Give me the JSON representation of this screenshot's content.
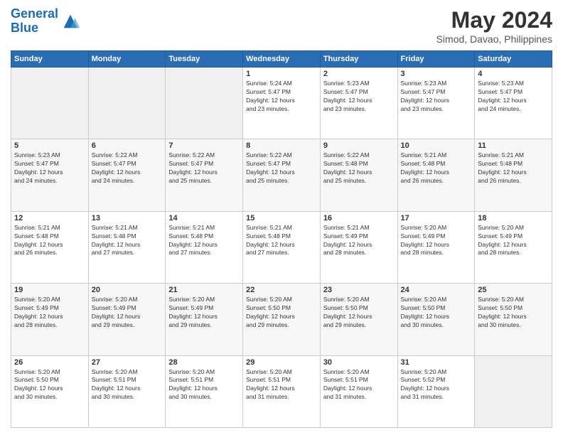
{
  "header": {
    "logo_line1": "General",
    "logo_line2": "Blue",
    "month_year": "May 2024",
    "location": "Simod, Davao, Philippines"
  },
  "weekdays": [
    "Sunday",
    "Monday",
    "Tuesday",
    "Wednesday",
    "Thursday",
    "Friday",
    "Saturday"
  ],
  "weeks": [
    [
      {
        "day": "",
        "info": ""
      },
      {
        "day": "",
        "info": ""
      },
      {
        "day": "",
        "info": ""
      },
      {
        "day": "1",
        "info": "Sunrise: 5:24 AM\nSunset: 5:47 PM\nDaylight: 12 hours\nand 23 minutes."
      },
      {
        "day": "2",
        "info": "Sunrise: 5:23 AM\nSunset: 5:47 PM\nDaylight: 12 hours\nand 23 minutes."
      },
      {
        "day": "3",
        "info": "Sunrise: 5:23 AM\nSunset: 5:47 PM\nDaylight: 12 hours\nand 23 minutes."
      },
      {
        "day": "4",
        "info": "Sunrise: 5:23 AM\nSunset: 5:47 PM\nDaylight: 12 hours\nand 24 minutes."
      }
    ],
    [
      {
        "day": "5",
        "info": "Sunrise: 5:23 AM\nSunset: 5:47 PM\nDaylight: 12 hours\nand 24 minutes."
      },
      {
        "day": "6",
        "info": "Sunrise: 5:22 AM\nSunset: 5:47 PM\nDaylight: 12 hours\nand 24 minutes."
      },
      {
        "day": "7",
        "info": "Sunrise: 5:22 AM\nSunset: 5:47 PM\nDaylight: 12 hours\nand 25 minutes."
      },
      {
        "day": "8",
        "info": "Sunrise: 5:22 AM\nSunset: 5:47 PM\nDaylight: 12 hours\nand 25 minutes."
      },
      {
        "day": "9",
        "info": "Sunrise: 5:22 AM\nSunset: 5:48 PM\nDaylight: 12 hours\nand 25 minutes."
      },
      {
        "day": "10",
        "info": "Sunrise: 5:21 AM\nSunset: 5:48 PM\nDaylight: 12 hours\nand 26 minutes."
      },
      {
        "day": "11",
        "info": "Sunrise: 5:21 AM\nSunset: 5:48 PM\nDaylight: 12 hours\nand 26 minutes."
      }
    ],
    [
      {
        "day": "12",
        "info": "Sunrise: 5:21 AM\nSunset: 5:48 PM\nDaylight: 12 hours\nand 26 minutes."
      },
      {
        "day": "13",
        "info": "Sunrise: 5:21 AM\nSunset: 5:48 PM\nDaylight: 12 hours\nand 27 minutes."
      },
      {
        "day": "14",
        "info": "Sunrise: 5:21 AM\nSunset: 5:48 PM\nDaylight: 12 hours\nand 27 minutes."
      },
      {
        "day": "15",
        "info": "Sunrise: 5:21 AM\nSunset: 5:48 PM\nDaylight: 12 hours\nand 27 minutes."
      },
      {
        "day": "16",
        "info": "Sunrise: 5:21 AM\nSunset: 5:49 PM\nDaylight: 12 hours\nand 28 minutes."
      },
      {
        "day": "17",
        "info": "Sunrise: 5:20 AM\nSunset: 5:49 PM\nDaylight: 12 hours\nand 28 minutes."
      },
      {
        "day": "18",
        "info": "Sunrise: 5:20 AM\nSunset: 5:49 PM\nDaylight: 12 hours\nand 28 minutes."
      }
    ],
    [
      {
        "day": "19",
        "info": "Sunrise: 5:20 AM\nSunset: 5:49 PM\nDaylight: 12 hours\nand 28 minutes."
      },
      {
        "day": "20",
        "info": "Sunrise: 5:20 AM\nSunset: 5:49 PM\nDaylight: 12 hours\nand 29 minutes."
      },
      {
        "day": "21",
        "info": "Sunrise: 5:20 AM\nSunset: 5:49 PM\nDaylight: 12 hours\nand 29 minutes."
      },
      {
        "day": "22",
        "info": "Sunrise: 5:20 AM\nSunset: 5:50 PM\nDaylight: 12 hours\nand 29 minutes."
      },
      {
        "day": "23",
        "info": "Sunrise: 5:20 AM\nSunset: 5:50 PM\nDaylight: 12 hours\nand 29 minutes."
      },
      {
        "day": "24",
        "info": "Sunrise: 5:20 AM\nSunset: 5:50 PM\nDaylight: 12 hours\nand 30 minutes."
      },
      {
        "day": "25",
        "info": "Sunrise: 5:20 AM\nSunset: 5:50 PM\nDaylight: 12 hours\nand 30 minutes."
      }
    ],
    [
      {
        "day": "26",
        "info": "Sunrise: 5:20 AM\nSunset: 5:50 PM\nDaylight: 12 hours\nand 30 minutes."
      },
      {
        "day": "27",
        "info": "Sunrise: 5:20 AM\nSunset: 5:51 PM\nDaylight: 12 hours\nand 30 minutes."
      },
      {
        "day": "28",
        "info": "Sunrise: 5:20 AM\nSunset: 5:51 PM\nDaylight: 12 hours\nand 30 minutes."
      },
      {
        "day": "29",
        "info": "Sunrise: 5:20 AM\nSunset: 5:51 PM\nDaylight: 12 hours\nand 31 minutes."
      },
      {
        "day": "30",
        "info": "Sunrise: 5:20 AM\nSunset: 5:51 PM\nDaylight: 12 hours\nand 31 minutes."
      },
      {
        "day": "31",
        "info": "Sunrise: 5:20 AM\nSunset: 5:52 PM\nDaylight: 12 hours\nand 31 minutes."
      },
      {
        "day": "",
        "info": ""
      }
    ]
  ]
}
